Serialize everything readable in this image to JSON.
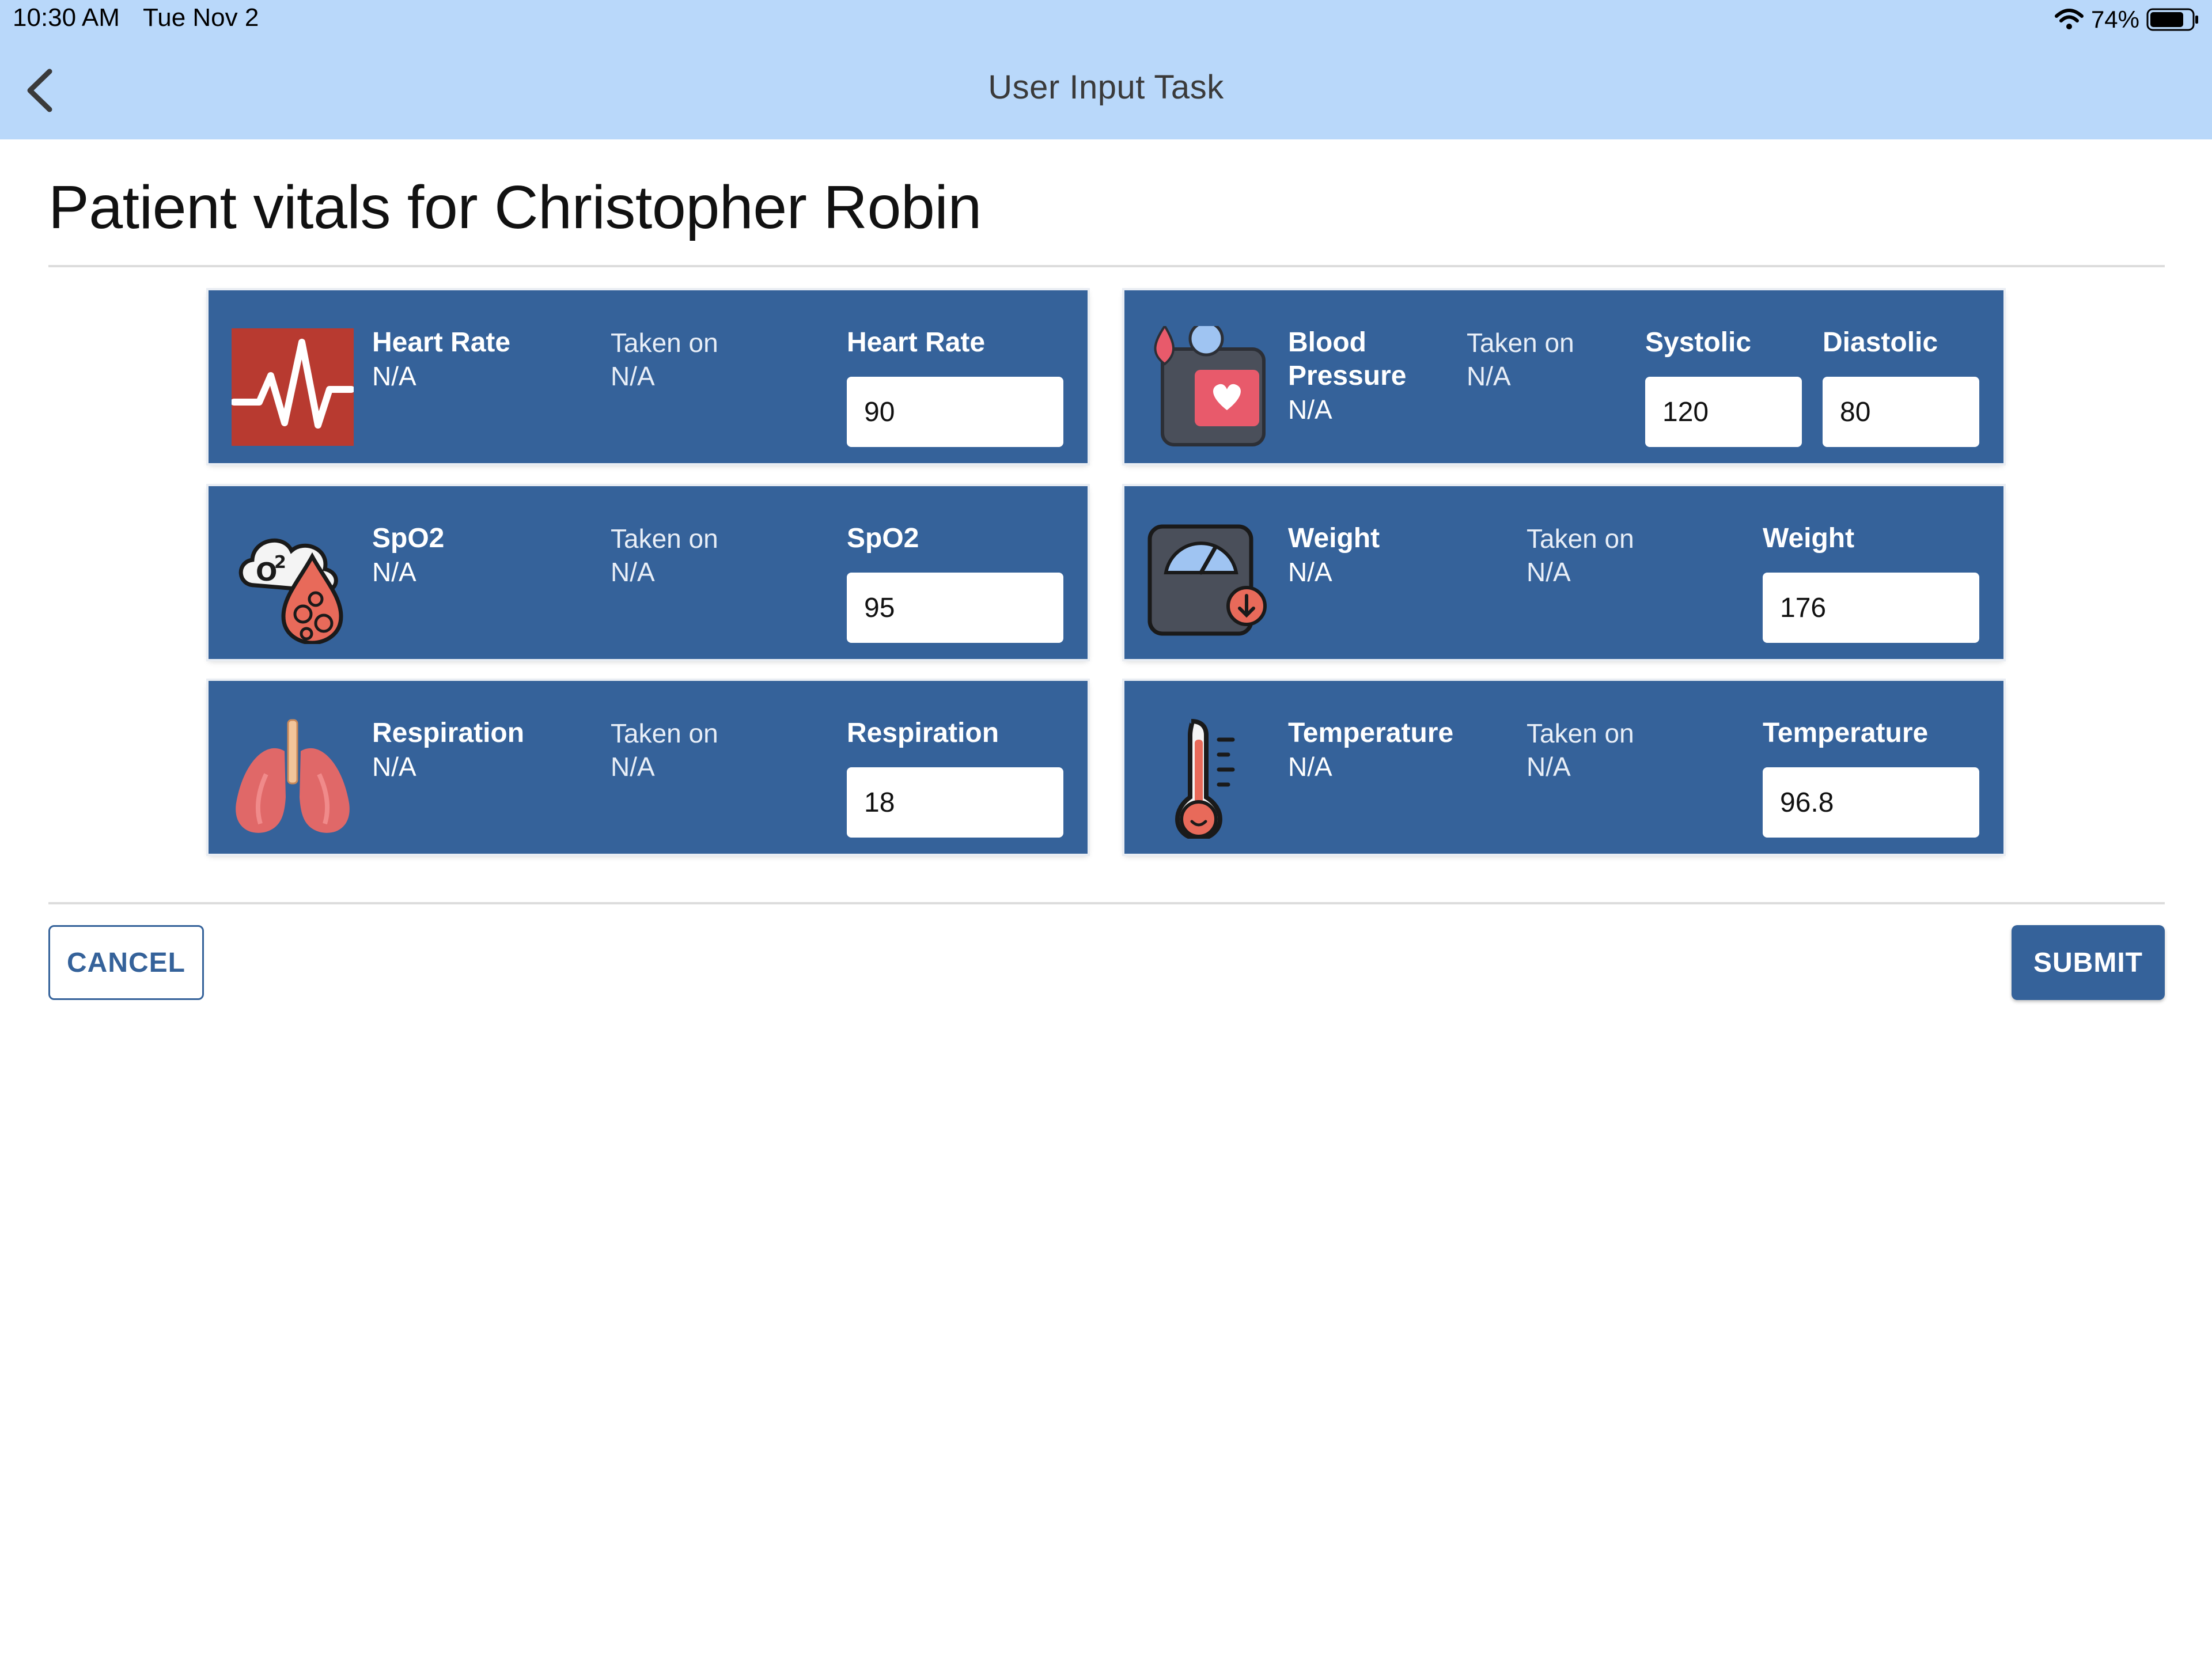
{
  "status_bar": {
    "time": "10:30 AM",
    "date": "Tue Nov 2",
    "battery": "74%"
  },
  "nav": {
    "title": "User Input Task",
    "back_icon": "chevron-left-icon"
  },
  "page": {
    "title": "Patient vitals for Christopher Robin"
  },
  "vitals": {
    "heart_rate": {
      "icon": "heart-rate-icon",
      "name": "Heart Rate",
      "last_value": "N/A",
      "taken_label": "Taken on",
      "taken_value": "N/A",
      "field_label": "Heart Rate",
      "field_value": "90"
    },
    "blood_pressure": {
      "icon": "blood-pressure-icon",
      "name": "Blood Pressure",
      "last_value": "N/A",
      "taken_label": "Taken on",
      "taken_value": "N/A",
      "systolic_label": "Systolic",
      "systolic_value": "120",
      "diastolic_label": "Diastolic",
      "diastolic_value": "80"
    },
    "spo2": {
      "icon": "oxygen-saturation-icon",
      "name": "SpO2",
      "last_value": "N/A",
      "taken_label": "Taken on",
      "taken_value": "N/A",
      "field_label": "SpO2",
      "field_value": "95"
    },
    "weight": {
      "icon": "weight-scale-icon",
      "name": "Weight",
      "last_value": "N/A",
      "taken_label": "Taken on",
      "taken_value": "N/A",
      "field_label": "Weight",
      "field_value": "176"
    },
    "respiration": {
      "icon": "lungs-icon",
      "name": "Respiration",
      "last_value": "N/A",
      "taken_label": "Taken on",
      "taken_value": "N/A",
      "field_label": "Respiration",
      "field_value": "18"
    },
    "temperature": {
      "icon": "thermometer-icon",
      "name": "Temperature",
      "last_value": "N/A",
      "taken_label": "Taken on",
      "taken_value": "N/A",
      "field_label": "Temperature",
      "field_value": "96.8"
    }
  },
  "actions": {
    "cancel_label": "CANCEL",
    "submit_label": "SUBMIT"
  },
  "colors": {
    "nav_background": "#b9d8fa",
    "card_background": "#35629a",
    "button_primary": "#35629a"
  }
}
